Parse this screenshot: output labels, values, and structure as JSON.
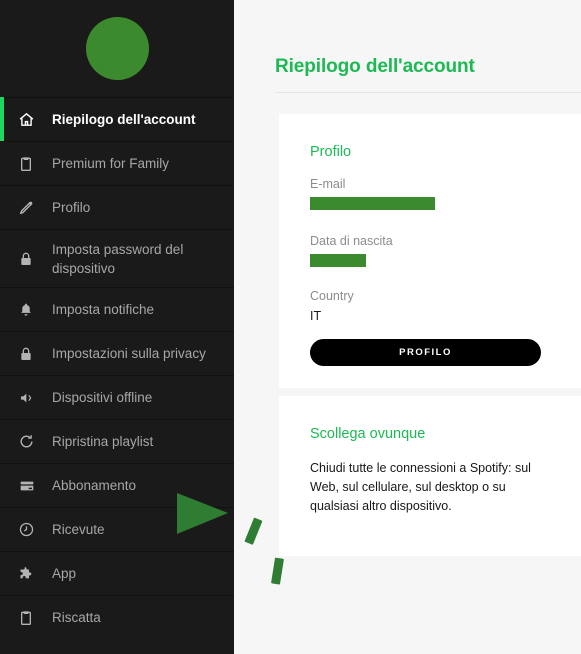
{
  "sidebar": {
    "avatar": {
      "name": "user-avatar",
      "color": "#3c8a2e"
    },
    "active_accent_color": "#1ed760",
    "items": [
      {
        "label": "Riepilogo dell'account",
        "icon": "home-icon",
        "active": true
      },
      {
        "label": "Premium for Family",
        "icon": "clipboard-icon",
        "active": false
      },
      {
        "label": "Profilo",
        "icon": "pen-icon",
        "active": false
      },
      {
        "label": "Imposta password del dispositivo",
        "icon": "lock-icon",
        "active": false
      },
      {
        "label": "Imposta notifiche",
        "icon": "bell-icon",
        "active": false
      },
      {
        "label": "Impostazioni sulla privacy",
        "icon": "lock-icon",
        "active": false
      },
      {
        "label": "Dispositivi offline",
        "icon": "speaker-icon",
        "active": false
      },
      {
        "label": "Ripristina playlist",
        "icon": "refresh-icon",
        "active": false
      },
      {
        "label": "Abbonamento",
        "icon": "credit-card-icon",
        "active": false
      },
      {
        "label": "Ricevute",
        "icon": "clock-icon",
        "active": false
      },
      {
        "label": "App",
        "icon": "puzzle-icon",
        "active": false
      },
      {
        "label": "Riscatta",
        "icon": "clipboard-icon",
        "active": false
      }
    ]
  },
  "main": {
    "page_title": "Riepilogo dell'account",
    "title_color": "#1db954",
    "profile_card": {
      "heading": "Profilo",
      "email_label": "E-mail",
      "email_value": "",
      "email_redacted": true,
      "dob_label": "Data di nascita",
      "dob_value": "",
      "dob_redacted": true,
      "country_label": "Country",
      "country_value": "IT",
      "button_label": "PROFILO"
    },
    "signout_card": {
      "heading": "Scollega ovunque",
      "body": "Chiudi tutte le connessioni a Spotify: sul Web, sul cellulare, sul desktop o su qualsiasi altro dispositivo."
    }
  },
  "annotation": {
    "arrow_color": "#2e7d32",
    "points_to": "Abbonamento"
  }
}
